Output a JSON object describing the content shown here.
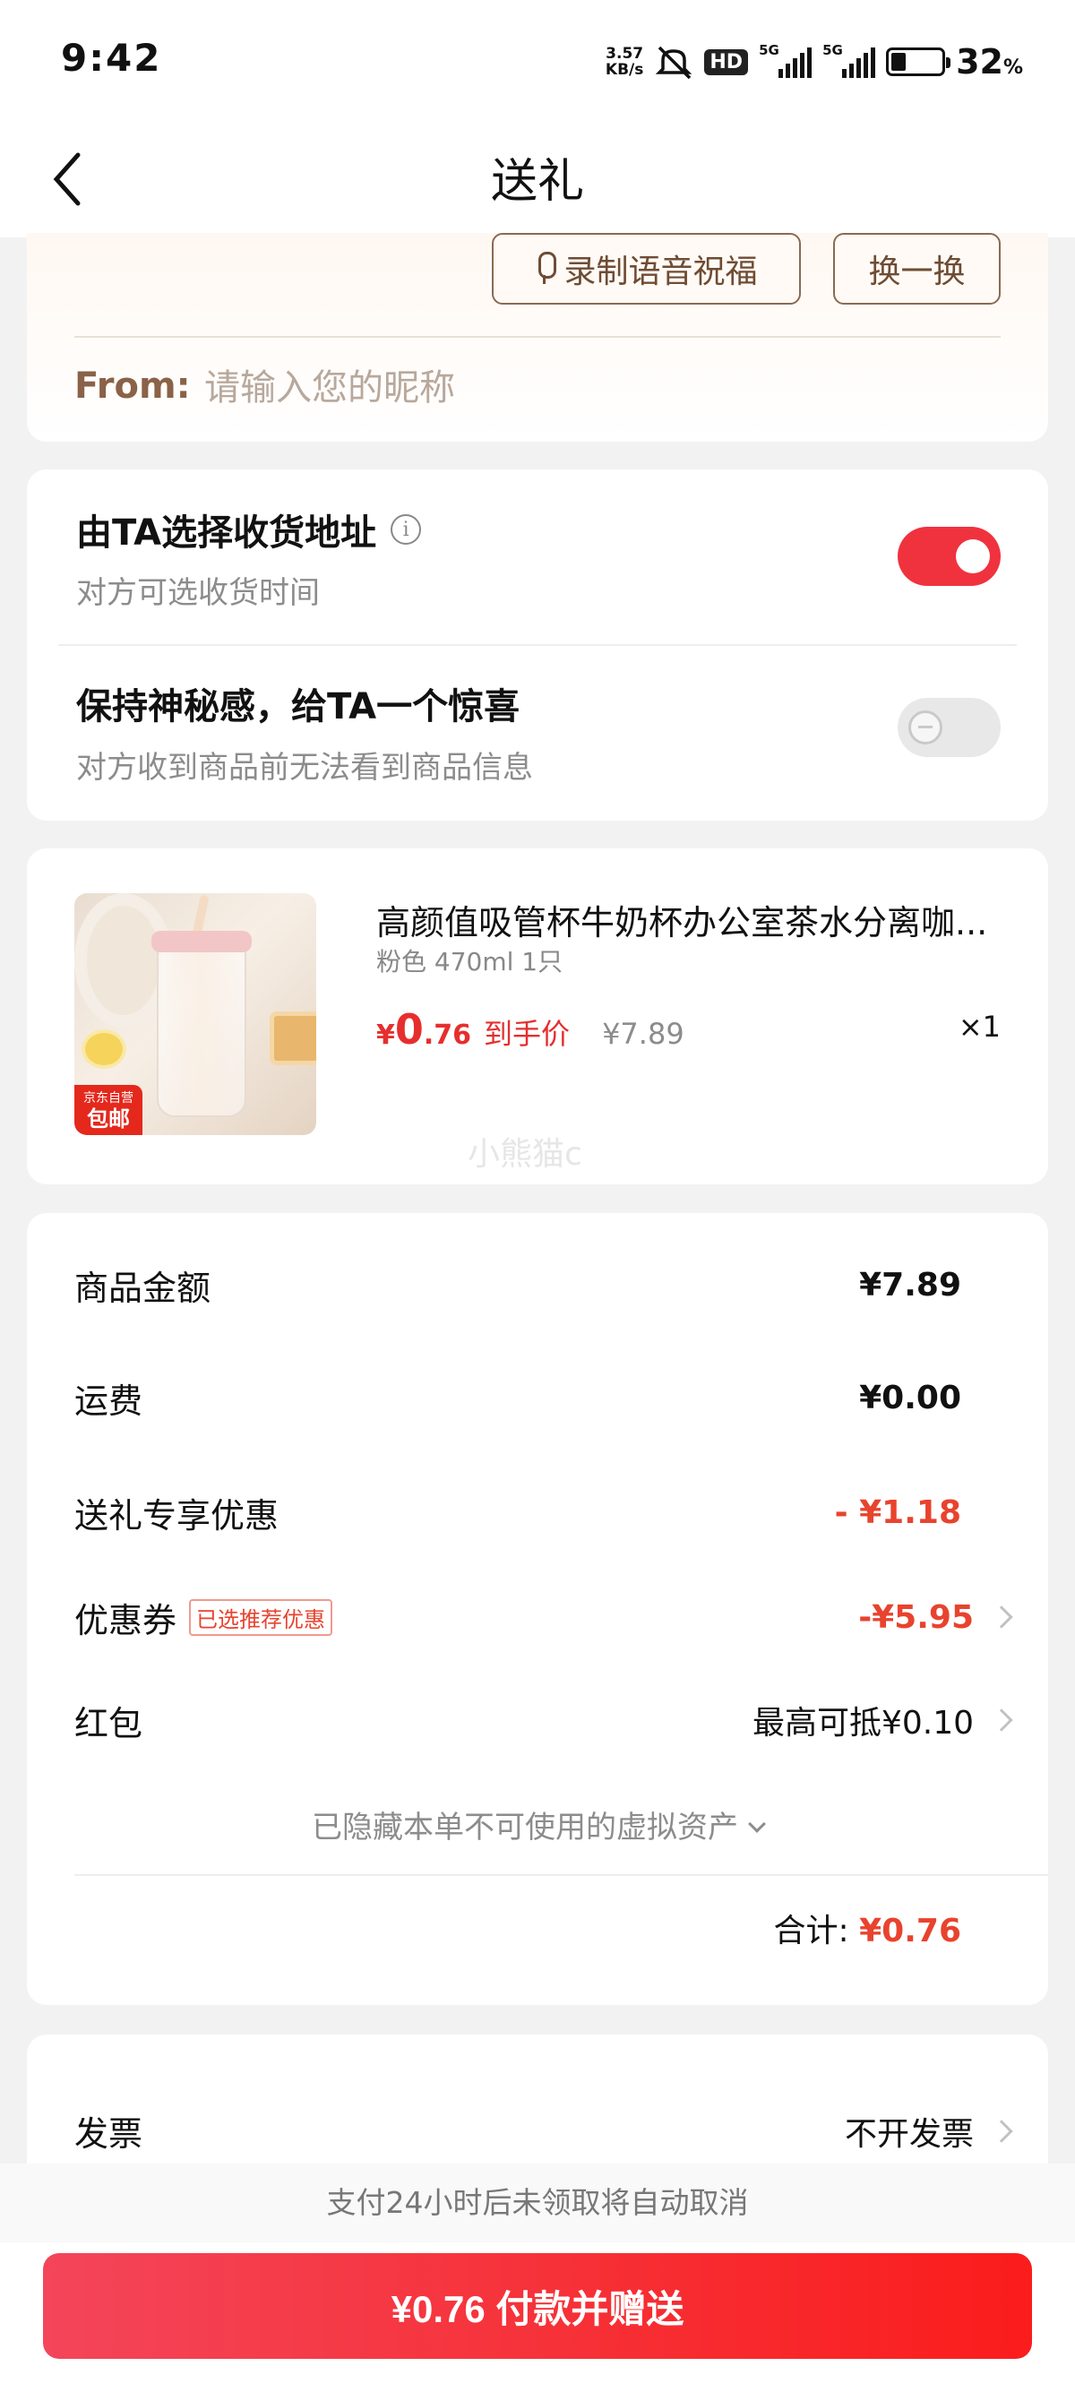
{
  "status_bar": {
    "time": "9:42",
    "net_speed_value": "3.57",
    "net_speed_unit": "KB/s",
    "hd_label": "HD",
    "net_type_1": "5G",
    "net_type_2": "5G",
    "battery_percent": "32",
    "battery_unit": "%"
  },
  "nav": {
    "title": "送礼"
  },
  "blessing": {
    "voice_button": "录制语音祝福",
    "change_button": "换一换",
    "from_label": "From:",
    "from_placeholder": "请输入您的昵称"
  },
  "options": {
    "address": {
      "title": "由TA选择收货地址",
      "subtitle": "对方可选收货时间",
      "enabled": true
    },
    "surprise": {
      "title": "保持神秘感，给TA一个惊喜",
      "subtitle": "对方收到商品前无法看到商品信息",
      "enabled": false
    }
  },
  "product": {
    "title": "高颜值吸管杯牛奶杯办公室茶水分离咖...",
    "spec": "粉色 470ml 1只",
    "badge_top": "京东自营",
    "badge_bottom": "包邮",
    "price_symbol": "¥",
    "price_int": "0",
    "price_dec": ".76",
    "price_tag": "到手价",
    "original_price": "¥7.89",
    "quantity": "×1",
    "watermark": "小熊猫c"
  },
  "details": {
    "goods_amount_label": "商品金额",
    "goods_amount": "¥7.89",
    "shipping_label": "运费",
    "shipping": "¥0.00",
    "gift_discount_label": "送礼专享优惠",
    "gift_discount": "- ¥1.18",
    "coupon_label": "优惠券",
    "coupon_tag": "已选推荐优惠",
    "coupon_value": "-¥5.95",
    "redpacket_label": "红包",
    "redpacket_value": "最高可抵¥0.10",
    "hidden_assets": "已隐藏本单不可使用的虚拟资产",
    "total_label": "合计:",
    "total_value": "¥0.76"
  },
  "invoice": {
    "label": "发票",
    "value": "不开发票"
  },
  "bottom": {
    "notice": "支付24小时后未领取将自动取消",
    "pay_button": "¥0.76 付款并赠送"
  },
  "colors": {
    "accent_red": "#f0323e",
    "price_red": "#e8432e",
    "brown": "#8a6248"
  }
}
